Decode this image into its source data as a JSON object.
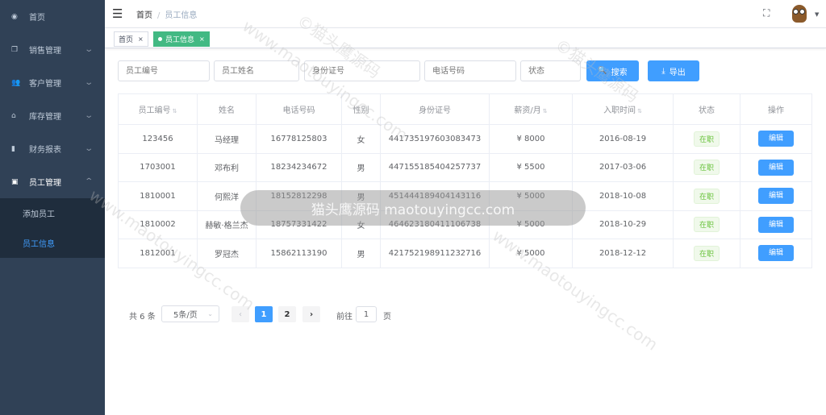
{
  "sidebar": {
    "items": [
      {
        "label": "首页",
        "icon": "dashboard-icon",
        "glyph": "◉"
      },
      {
        "label": "销售管理",
        "icon": "copy-icon",
        "glyph": "❐",
        "chevron": "⌄"
      },
      {
        "label": "客户管理",
        "icon": "people-icon",
        "glyph": "👥",
        "chevron": "⌄"
      },
      {
        "label": "库存管理",
        "icon": "home-icon",
        "glyph": "⌂",
        "chevron": "⌄"
      },
      {
        "label": "财务报表",
        "icon": "bar-chart-icon",
        "glyph": "▮",
        "chevron": "⌄"
      },
      {
        "label": "员工管理",
        "icon": "id-badge-icon",
        "glyph": "▣",
        "chevron": "⌃"
      }
    ],
    "submenu": [
      {
        "label": "添加员工"
      },
      {
        "label": "员工信息"
      }
    ]
  },
  "topbar": {
    "menu_icon": "☰",
    "breadcrumb": [
      "首页",
      "员工信息"
    ],
    "separator": "/",
    "fullscreen_icon": "⛶",
    "caret": "▼"
  },
  "tags": [
    {
      "label": "首页",
      "close": "×"
    },
    {
      "label": "员工信息",
      "close": "×"
    }
  ],
  "filters": {
    "employee_id": "员工编号",
    "name": "员工姓名",
    "id_card": "身份证号",
    "phone": "电话号码",
    "status": "状态"
  },
  "buttons": {
    "search": "搜索",
    "search_icon": "🔍",
    "export": "导出",
    "export_icon": "⤓"
  },
  "table": {
    "headers": [
      "员工编号",
      "姓名",
      "电话号码",
      "性别",
      "身份证号",
      "薪资/月",
      "入职时间",
      "状态",
      "操作"
    ],
    "sort_icon": "⇅",
    "rows": [
      {
        "id": "123456",
        "name": "马经理",
        "phone": "16778125803",
        "gender": "女",
        "id_card": "441735197603083473",
        "salary": "¥ 8000",
        "hire_date": "2016-08-19",
        "status": "在职",
        "action": "编辑"
      },
      {
        "id": "1703001",
        "name": "邓布利",
        "phone": "18234234672",
        "gender": "男",
        "id_card": "447155185404257737",
        "salary": "¥ 5500",
        "hire_date": "2017-03-06",
        "status": "在职",
        "action": "编辑"
      },
      {
        "id": "1810001",
        "name": "何熙洋",
        "phone": "18152812298",
        "gender": "男",
        "id_card": "451444189404143116",
        "salary": "¥ 5000",
        "hire_date": "2018-10-08",
        "status": "在职",
        "action": "编辑"
      },
      {
        "id": "1810002",
        "name": "赫敏·格兰杰",
        "phone": "18757331422",
        "gender": "女",
        "id_card": "464623180411106738",
        "salary": "¥ 5000",
        "hire_date": "2018-10-29",
        "status": "在职",
        "action": "编辑"
      },
      {
        "id": "1812001",
        "name": "罗冠杰",
        "phone": "15862113190",
        "gender": "男",
        "id_card": "421752198911232716",
        "salary": "¥ 5000",
        "hire_date": "2018-12-12",
        "status": "在职",
        "action": "编辑"
      }
    ]
  },
  "pagination": {
    "total": "共 6 条",
    "page_size": "5条/页",
    "size_caret": "⌄",
    "prev": "‹",
    "next": "›",
    "pages": [
      "1",
      "2"
    ],
    "goto_label": "前往",
    "goto_value": "1",
    "goto_suffix": "页"
  },
  "watermark": {
    "text": "www.maotouyingcc.com",
    "text_cn": "©猫头鹰源码",
    "banner": "猫头鹰源码 maotouyingcc.com"
  },
  "colors": {
    "sidebar_bg": "#304156",
    "primary": "#409eff",
    "active_tag": "#42b983",
    "status_green": "#67c23a"
  }
}
